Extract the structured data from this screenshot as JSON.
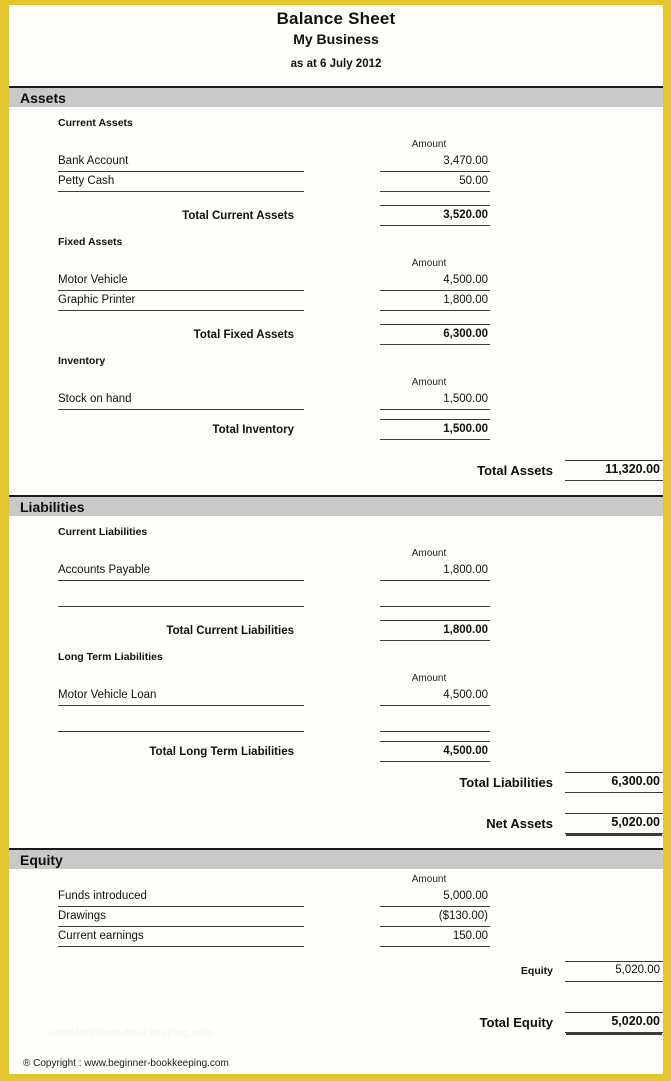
{
  "header": {
    "title": "Balance Sheet",
    "business": "My Business",
    "date_line": "as at 6 July 2012"
  },
  "colors": {
    "page_border": "#e3c62e",
    "section_bar": "#c9c9c9",
    "rule": "#3b3b3b",
    "text": "#111111"
  },
  "amount_header": "Amount",
  "sections": {
    "assets": {
      "title": "Assets",
      "groups": {
        "current_assets": {
          "title": "Current Assets",
          "amount_header": "Amount",
          "rows": [
            {
              "label": "Bank Account",
              "amount": "3,470.00"
            },
            {
              "label": "Petty Cash",
              "amount": "50.00"
            }
          ],
          "total_label": "Total Current Assets",
          "total_amount": "3,520.00"
        },
        "fixed_assets": {
          "title": "Fixed Assets",
          "amount_header": "Amount",
          "rows": [
            {
              "label": "Motor Vehicle",
              "amount": "4,500.00"
            },
            {
              "label": "Graphic Printer",
              "amount": "1,800.00"
            }
          ],
          "total_label": "Total Fixed Assets",
          "total_amount": "6,300.00"
        },
        "inventory": {
          "title": "Inventory",
          "amount_header": "Amount",
          "rows": [
            {
              "label": "Stock on hand",
              "amount": "1,500.00"
            }
          ],
          "total_label": "Total Inventory",
          "total_amount": "1,500.00"
        }
      },
      "grand_total_label": "Total Assets",
      "grand_total_amount": "11,320.00"
    },
    "liabilities": {
      "title": "Liabilities",
      "groups": {
        "current_liabilities": {
          "title": "Current Liabilities",
          "amount_header": "Amount",
          "rows": [
            {
              "label": "Accounts Payable",
              "amount": "1,800.00"
            },
            {
              "label": "",
              "amount": ""
            }
          ],
          "total_label": "Total Current Liabilities",
          "total_amount": "1,800.00"
        },
        "long_term_liabilities": {
          "title": "Long Term Liabilities",
          "amount_header": "Amount",
          "rows": [
            {
              "label": "Motor Vehicle Loan",
              "amount": "4,500.00"
            },
            {
              "label": "",
              "amount": ""
            }
          ],
          "total_label": "Total Long Term Liabilities",
          "total_amount": "4,500.00"
        }
      },
      "grand_total_label": "Total Liabilities",
      "grand_total_amount": "6,300.00",
      "net_assets_label": "Net Assets",
      "net_assets_amount": "5,020.00"
    },
    "equity": {
      "title": "Equity",
      "amount_header": "Amount",
      "rows": [
        {
          "label": "Funds introduced",
          "amount": "5,000.00"
        },
        {
          "label": "Drawings",
          "amount": "($130.00)"
        },
        {
          "label": "Current earnings",
          "amount": "150.00"
        }
      ],
      "subtotal_label": "Equity",
      "subtotal_amount": "5,020.00",
      "grand_total_label": "Total Equity",
      "grand_total_amount": "5,020.00"
    }
  },
  "watermark": "www.beginner-bookkeeping.com",
  "copyright": "® Copyright : www.beginner-bookkeeping.com"
}
